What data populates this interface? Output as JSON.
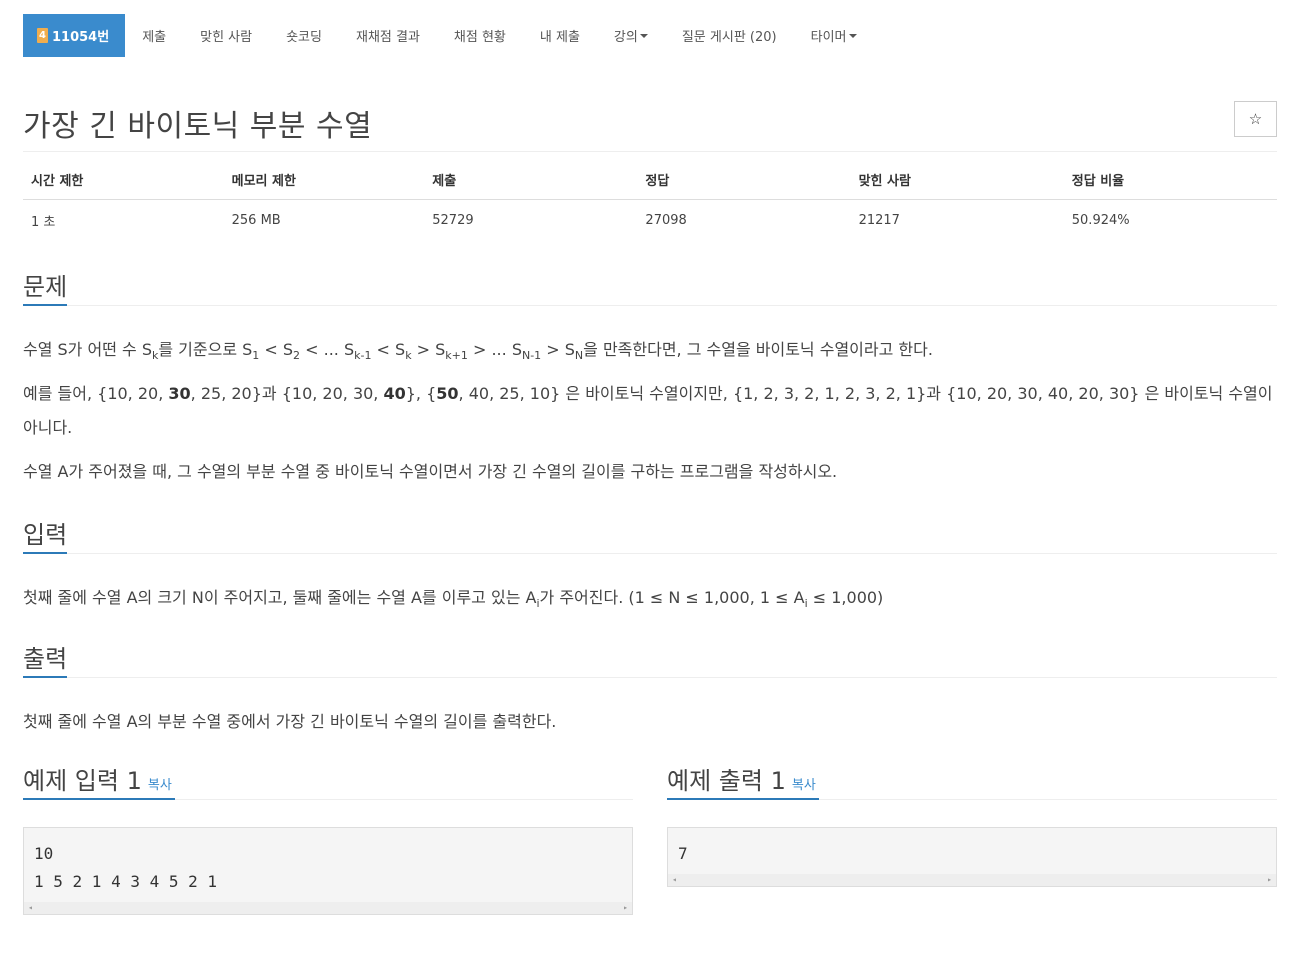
{
  "nav": {
    "badge": "4",
    "problem_id": "11054번",
    "items": [
      "제출",
      "맞힌 사람",
      "숏코딩",
      "재채점 결과",
      "채점 현황",
      "내 제출",
      "강의",
      "질문 게시판 (20)",
      "타이머"
    ]
  },
  "title": "가장 긴 바이토닉 부분 수열",
  "star": "☆",
  "info": {
    "headers": [
      "시간 제한",
      "메모리 제한",
      "제출",
      "정답",
      "맞힌 사람",
      "정답 비율"
    ],
    "values": [
      "1 초",
      "256 MB",
      "52729",
      "27098",
      "21217",
      "50.924%"
    ]
  },
  "sections": {
    "problem": "문제",
    "input": "입력",
    "output": "출력"
  },
  "problem_lines": {
    "l1_a": "수열 S가 어떤 수 S",
    "l1_k": "k",
    "l1_b": "를 기준으로 S",
    "l1_1": "1",
    "l1_c": " < S",
    "l1_2": "2",
    "l1_d": " < ... S",
    "l1_km1": "k-1",
    "l1_e": " < S",
    "l1_k2": "k",
    "l1_f": " > S",
    "l1_kp1": "k+1",
    "l1_g": " > ... S",
    "l1_nm1": "N-1",
    "l1_h": " > S",
    "l1_n": "N",
    "l1_i": "을 만족한다면, 그 수열을 바이토닉 수열이라고 한다.",
    "l2_a": "예를 들어, {10, 20, ",
    "l2_b30": "30",
    "l2_c": ", 25, 20}과 {10, 20, 30, ",
    "l2_d40": "40",
    "l2_e": "}, {",
    "l2_f50": "50",
    "l2_g": ", 40, 25, 10} 은 바이토닉 수열이지만,  {1, 2, 3, 2, 1, 2, 3, 2, 1}과 {10, 20, 30, 40, 20, 30} 은 바이토닉 수열이 아니다.",
    "l3": "수열 A가 주어졌을 때, 그 수열의 부분 수열 중 바이토닉 수열이면서 가장 긴 수열의 길이를 구하는 프로그램을 작성하시오."
  },
  "input_text": {
    "a": "첫째 줄에 수열 A의 크기 N이 주어지고, 둘째 줄에는 수열 A를 이루고 있는 A",
    "i": "i",
    "b": "가 주어진다. (1 ≤ N ≤ 1,000, 1 ≤ A",
    "i2": "i",
    "c": " ≤ 1,000)"
  },
  "output_text": "첫째 줄에 수열 A의 부분 수열 중에서 가장 긴 바이토닉 수열의 길이를 출력한다.",
  "samples": {
    "input_title": "예제 입력 1",
    "output_title": "예제 출력 1",
    "copy": "복사",
    "input_body": "10\n1 5 2 1 4 3 4 5 2 1",
    "output_body": "7",
    "scroll_left": "◂",
    "scroll_right": "▸"
  }
}
